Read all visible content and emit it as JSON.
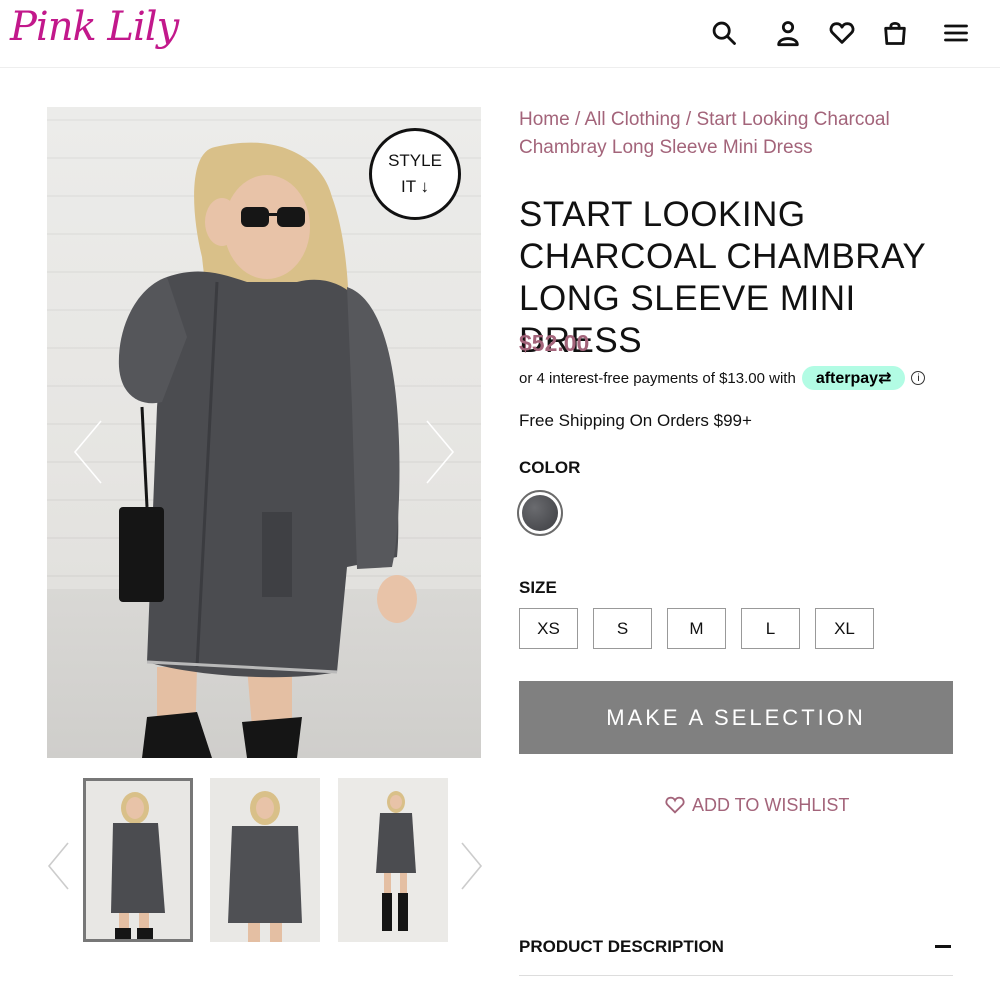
{
  "header": {
    "logo_text": "Pink Lily",
    "icons": [
      "search-icon",
      "account-icon",
      "wishlist-heart-icon",
      "shopping-bag-icon",
      "menu-icon"
    ]
  },
  "gallery": {
    "style_it_line1": "STYLE",
    "style_it_line2": "IT ↓",
    "thumbnail_count": 3,
    "active_thumbnail": 1
  },
  "breadcrumb": {
    "home": "Home",
    "sep": " / ",
    "category": "All Clothing",
    "current": "Start Looking Charcoal Chambray Long Sleeve Mini Dress"
  },
  "product": {
    "title": "Start Looking Charcoal Chambray Long Sleeve Mini Dress",
    "price": "$52.00",
    "afterpay_text": "or 4 interest-free payments of $13.00 with",
    "afterpay_brand": "afterpay",
    "info_icon": "ⓘ",
    "shipping": "Free Shipping On Orders $99+"
  },
  "options": {
    "color_label": "COLOR",
    "color_swatch": "#4b4c50",
    "size_label": "SIZE",
    "sizes": [
      "XS",
      "S",
      "M",
      "L",
      "XL"
    ]
  },
  "actions": {
    "cta": "MAKE A SELECTION",
    "wishlist": "ADD TO WISHLIST"
  },
  "accordion": {
    "description_label": "PRODUCT DESCRIPTION"
  },
  "colors": {
    "brand_pink": "#c2188b",
    "accent_mauve": "#a3647a",
    "cta_gray": "#808080",
    "afterpay_mint": "#b2fce4"
  }
}
